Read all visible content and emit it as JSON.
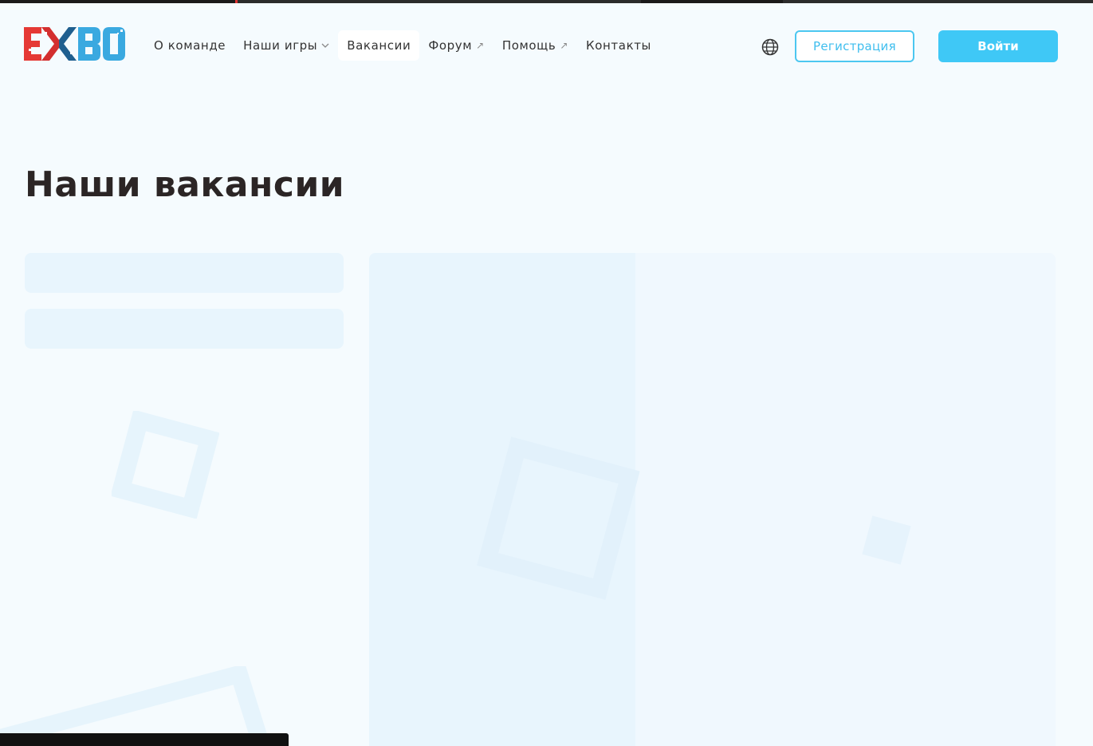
{
  "brand": {
    "logo_text": "EXBO",
    "colors": {
      "red": "#e53935",
      "blue": "#3aa9e0",
      "dark_blue": "#1f5f8f"
    }
  },
  "nav": {
    "items": [
      {
        "label": "О команде",
        "suffix": ""
      },
      {
        "label": "Наши игры",
        "suffix": "chevron-down"
      },
      {
        "label": "Вакансии",
        "suffix": ""
      },
      {
        "label": "Форум",
        "suffix": "↗"
      },
      {
        "label": "Помощь",
        "suffix": "↗"
      },
      {
        "label": "Контакты",
        "suffix": ""
      }
    ],
    "active_index": 2
  },
  "header": {
    "language_icon": "globe-icon",
    "register_label": "Регистрация",
    "login_label": "Войти",
    "accent": "#3fc8f6"
  },
  "main": {
    "title": "Наши вакансии"
  }
}
